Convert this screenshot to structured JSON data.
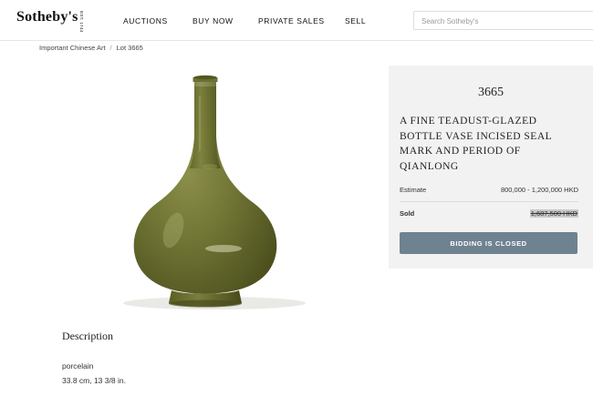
{
  "header": {
    "logo_text": "Sotheby's",
    "logo_est": "EST. 1744",
    "nav": [
      "AUCTIONS",
      "BUY NOW",
      "PRIVATE SALES",
      "SELL"
    ],
    "search_placeholder": "Search Sotheby's"
  },
  "breadcrumb": {
    "items": [
      "Important Chinese Art",
      "Lot 3665"
    ],
    "separator": "/"
  },
  "image": {
    "subject": "teadust-glazed bottle vase",
    "glaze_color": "#6b7030"
  },
  "lot": {
    "number": "3665",
    "title": "A FINE TEADUST-GLAZED BOTTLE VASE INCISED SEAL MARK AND PERIOD OF QIANLONG",
    "estimate_label": "Estimate",
    "estimate_value": "800,000 - 1,200,000 HKD",
    "sold_label": "Sold",
    "sold_value": "1,687,500 HKD",
    "button_label": "BIDDING IS CLOSED",
    "button_color": "#6f8290",
    "panel_color": "#f2f2f2"
  },
  "description": {
    "heading": "Description",
    "material": "porcelain",
    "dimensions": "33.8 cm, 13 3/8  in."
  }
}
